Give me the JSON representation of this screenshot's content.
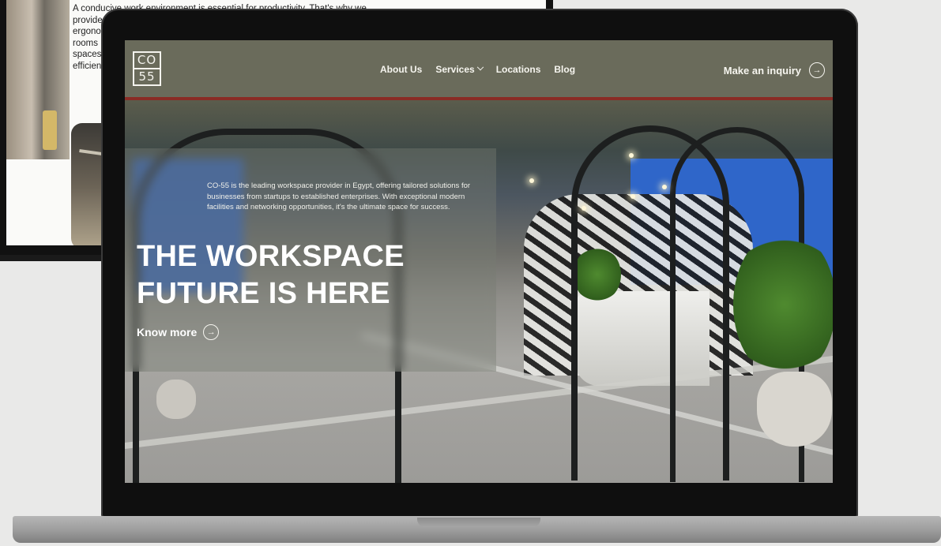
{
  "background_page": {
    "text_lines": [
      "A conducive work environment is essential for productivity. That's why we",
      "provide",
      "ergono",
      "rooms",
      "spaces",
      "efficien"
    ]
  },
  "header": {
    "logo_top": "CO",
    "logo_bottom": "55",
    "nav": [
      {
        "label": "About Us"
      },
      {
        "label": "Services"
      },
      {
        "label": "Locations"
      },
      {
        "label": "Blog"
      }
    ],
    "cta_label": "Make an inquiry"
  },
  "hero": {
    "description": "CO-55 is the leading workspace provider in Egypt, offering tailored solutions for businesses from startups to established enterprises. With exceptional modern facilities and networking opportunities, it's the ultimate space for success.",
    "title_line1": "THE WORKSPACE",
    "title_line2": "FUTURE IS HERE",
    "know_more_label": "Know more"
  },
  "icons": {
    "cta_arrow": "arrow-right-circle-icon",
    "know_more_arrow": "arrow-right-circle-icon",
    "services_dropdown": "chevron-down-icon"
  },
  "colors": {
    "header_bg": "#6a6b5b",
    "text_light": "#f6f5ef",
    "accent_blue": "#2f66c9"
  }
}
